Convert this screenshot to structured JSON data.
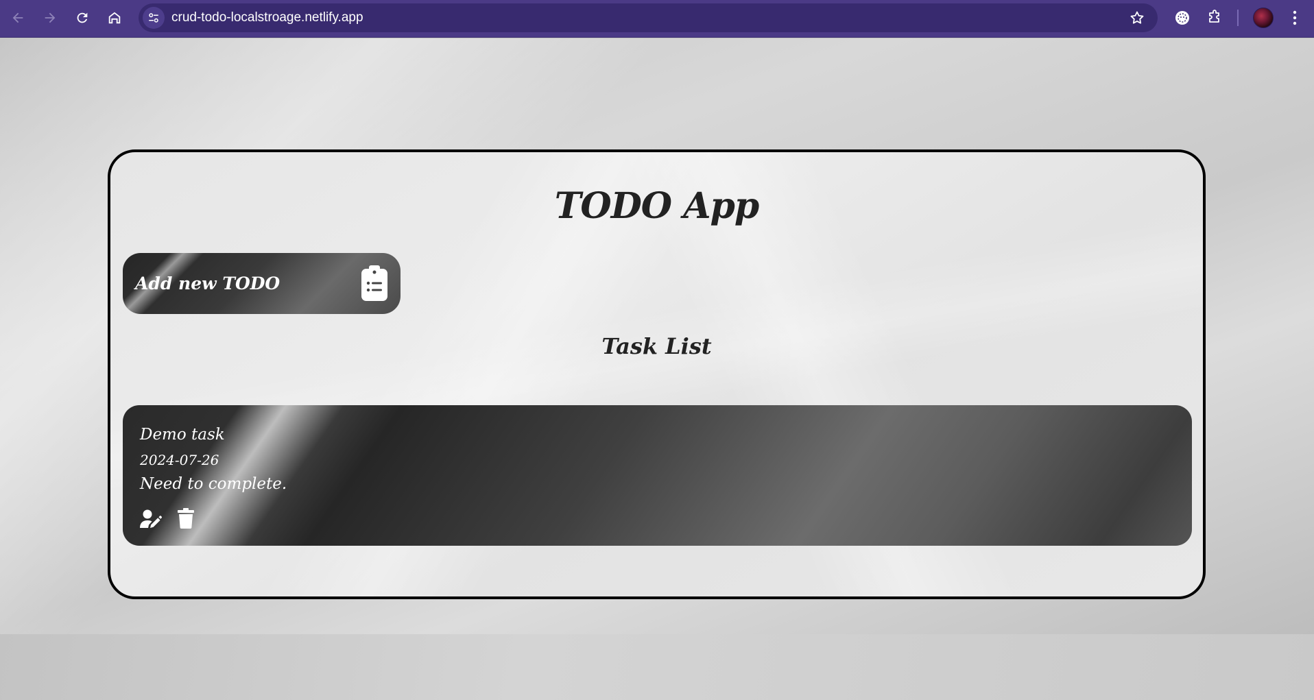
{
  "browser": {
    "url": "crud-todo-localstroage.netlify.app",
    "icons": [
      "back-icon",
      "forward-icon",
      "reload-icon",
      "home-icon",
      "site-info-icon",
      "bookmark-star-icon",
      "extension-icon",
      "puzzle-icon",
      "profile-avatar",
      "more-menu-icon"
    ],
    "colors": {
      "toolbar": "#4b3a86",
      "omnibox": "#382a6f"
    }
  },
  "app": {
    "title": "TODO App",
    "add_button_label": "Add new TODO",
    "add_button_icon": "clipboard-list-icon",
    "list_title": "Task List",
    "tasks": [
      {
        "title": "Demo task",
        "date": "2024-07-26",
        "description": "Need to complete.",
        "actions": [
          "user-edit-icon",
          "trash-icon"
        ]
      }
    ]
  }
}
